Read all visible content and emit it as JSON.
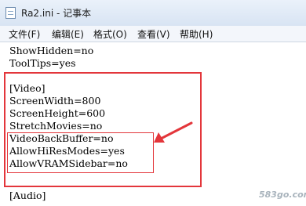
{
  "window": {
    "title": "Ra2.ini - 记事本",
    "icon": "notepad-icon"
  },
  "menu": [
    {
      "label": "文件(F)"
    },
    {
      "label": "编辑(E)"
    },
    {
      "label": "格式(O)"
    },
    {
      "label": "查看(V)"
    },
    {
      "label": "帮助(H)"
    }
  ],
  "editor": {
    "lines": [
      "ShowHidden=no",
      "ToolTips=yes",
      "",
      "[Video]",
      "ScreenWidth=800",
      "ScreenHeight=600",
      "StretchMovies=no",
      "VideoBackBuffer=no",
      "AllowHiResModes=yes",
      "AllowVRAMSidebar=no",
      "",
      "[Audio]"
    ]
  },
  "annotations": {
    "highlight_color": "#e3363b"
  },
  "watermark": {
    "text": "583go.com"
  }
}
